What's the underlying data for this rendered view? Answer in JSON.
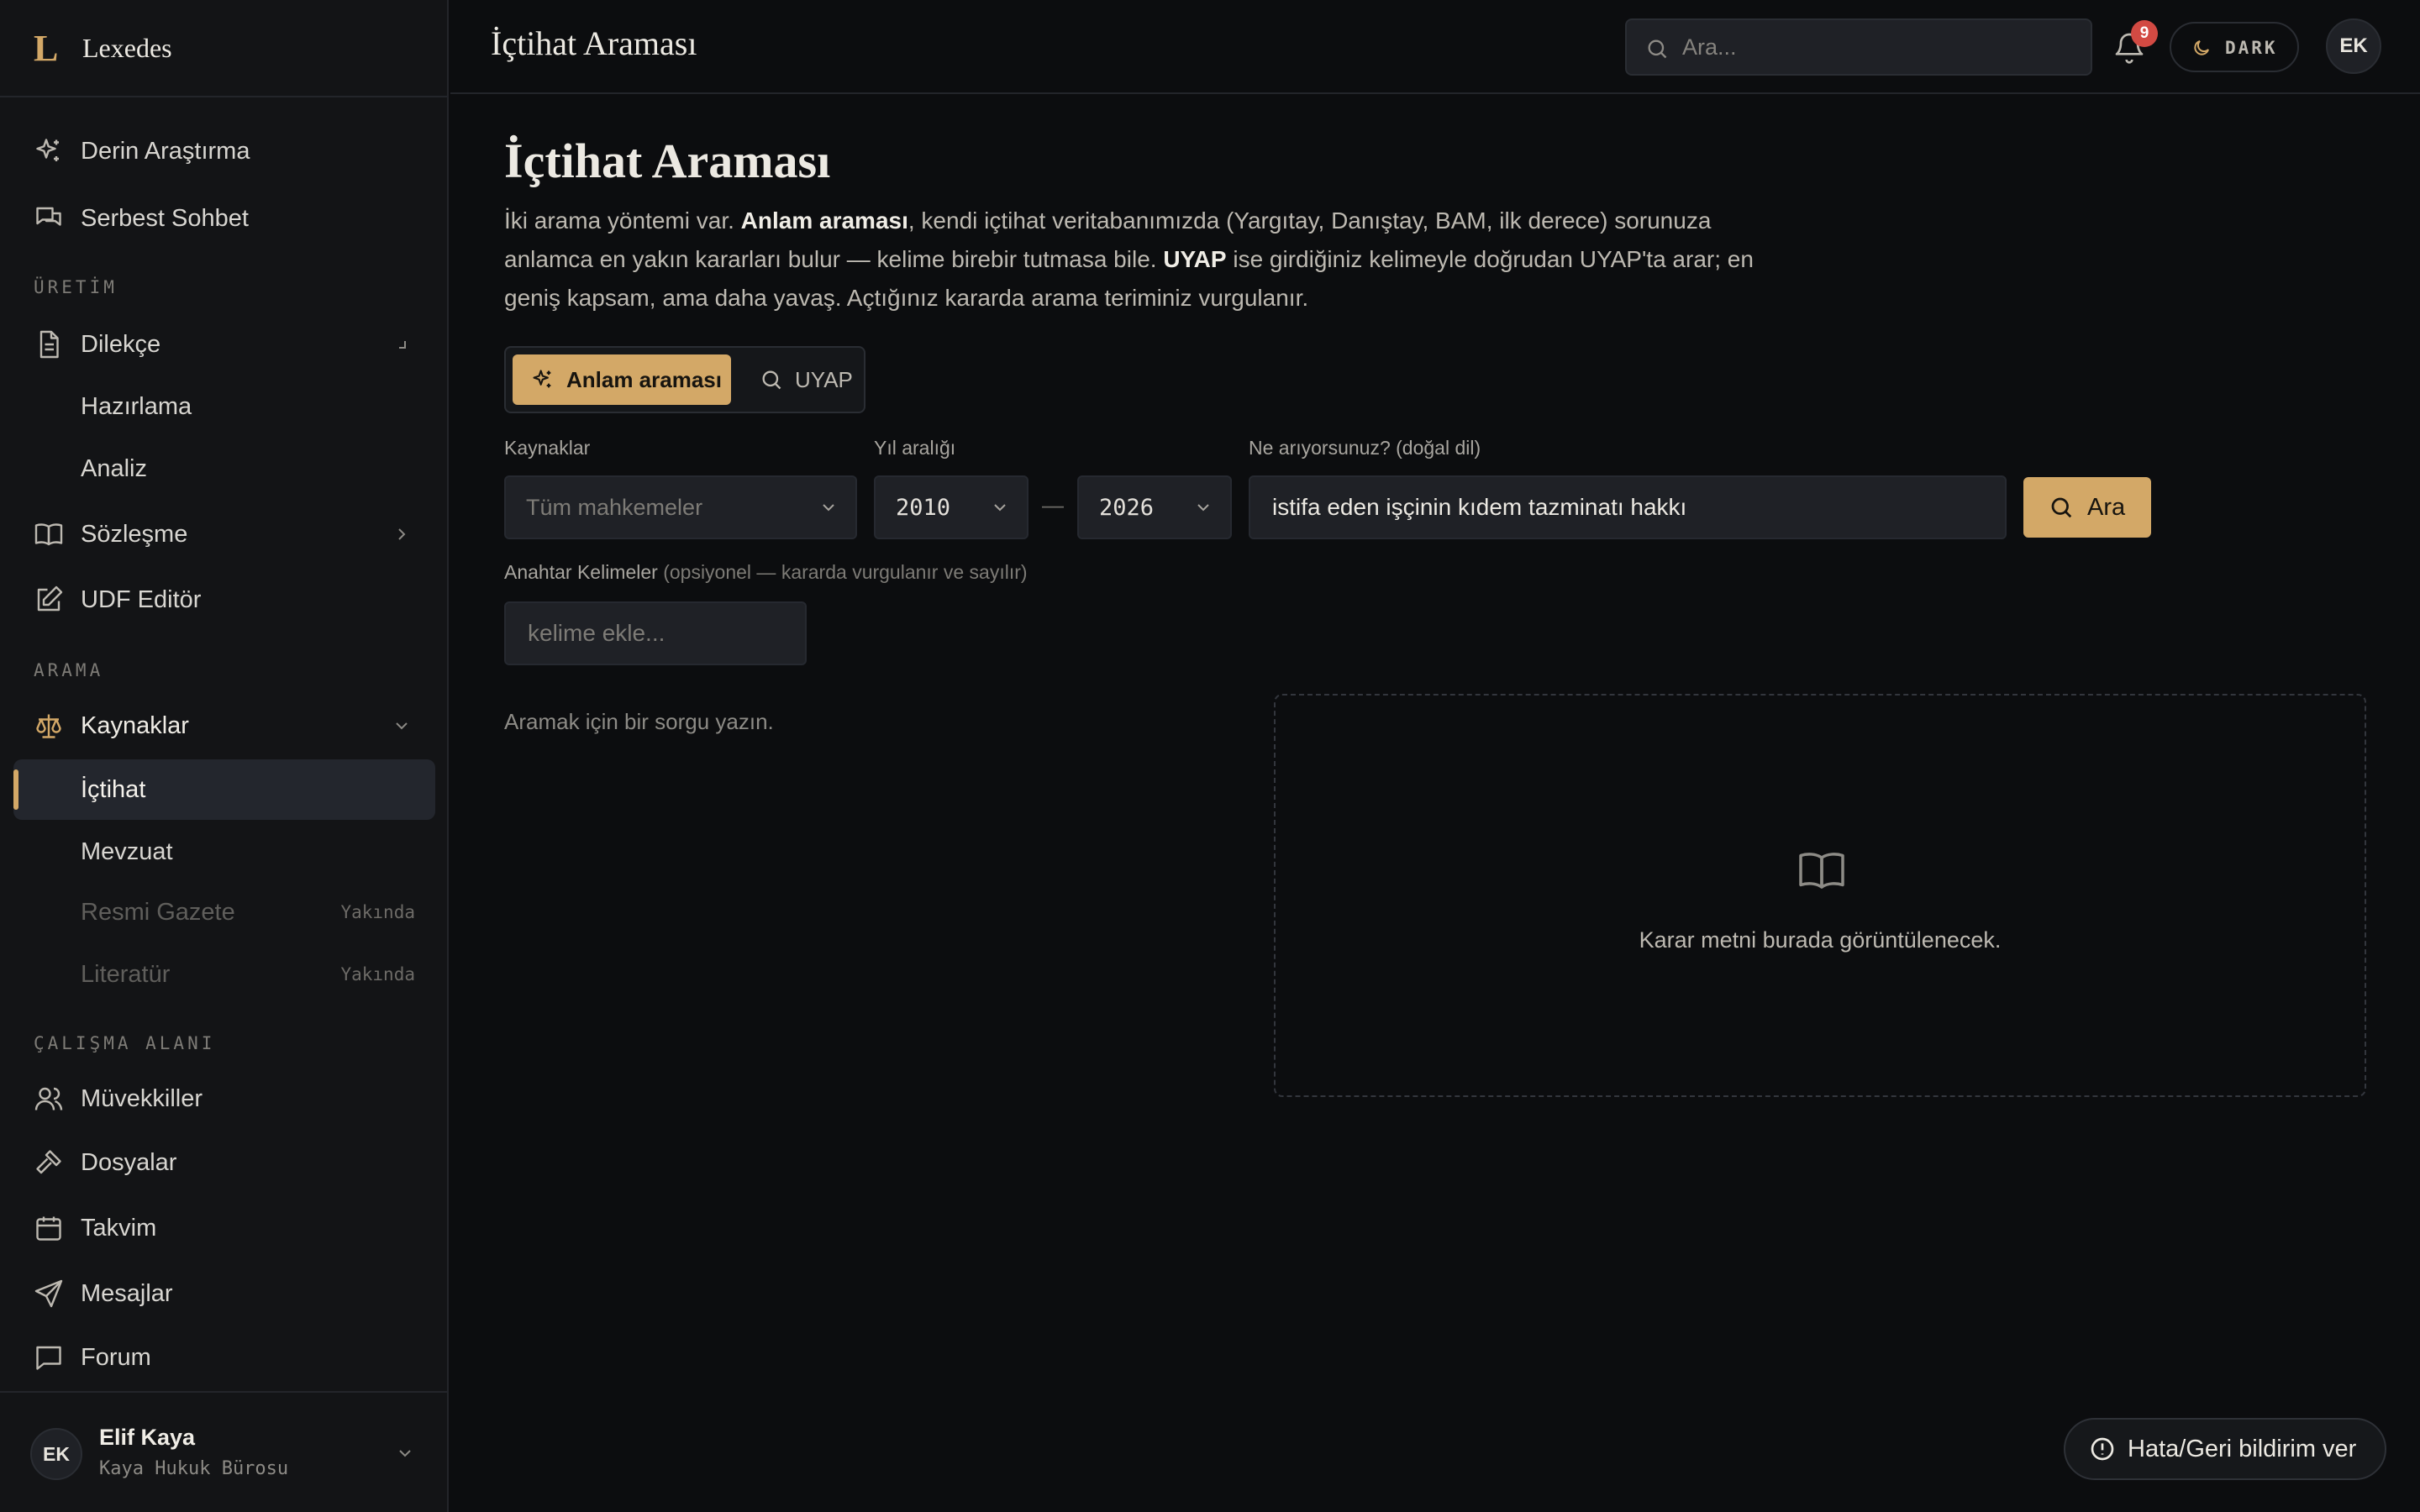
{
  "app": {
    "logo": "L",
    "name": "Lexedes"
  },
  "sidebar": {
    "top_items": [
      {
        "label": "Derin Araştırma",
        "icon": "sparkles-icon"
      },
      {
        "label": "Serbest Sohbet",
        "icon": "chat-icon"
      }
    ],
    "sections": {
      "uretim": "ÜRETİM",
      "arama": "ARAMA",
      "calisma": "ÇALIŞMA ALANI"
    },
    "uretim_items": {
      "dilekce": "Dilekçe",
      "hazirlama": "Hazırlama",
      "analiz": "Analiz",
      "sozlesme": "Sözleşme",
      "udf": "UDF Editör"
    },
    "arama_items": {
      "kaynaklar": "Kaynaklar",
      "ictihat": "İçtihat",
      "mevzuat": "Mevzuat",
      "resmi_gazete": "Resmi Gazete",
      "literatur": "Literatür",
      "soon": "Yakında"
    },
    "calisma_items": {
      "muvekkiller": "Müvekkiller",
      "dosyalar": "Dosyalar",
      "takvim": "Takvim",
      "mesajlar": "Mesajlar",
      "forum": "Forum"
    },
    "user": {
      "initials": "EK",
      "name": "Elif Kaya",
      "org": "Kaya Hukuk Bürosu"
    }
  },
  "topbar": {
    "title": "İçtihat Araması",
    "search_placeholder": "Ara...",
    "notifications_count": "9",
    "theme_label": "DARK",
    "avatar_initials": "EK"
  },
  "main": {
    "heading": "İçtihat Araması",
    "desc": {
      "p1": "İki arama yöntemi var. ",
      "b1": "Anlam araması",
      "p2": ", kendi içtihat veritabanımızda (Yargıtay, Danıştay, BAM, ilk derece) sorunuza anlamca en yakın kararları bulur — kelime birebir tutmasa bile. ",
      "b2": "UYAP",
      "p3": " ise girdiğiniz kelimeyle doğrudan UYAP'ta arar; en geniş kapsam, ama daha yavaş. Açtığınız kararda arama teriminiz vurgulanır."
    },
    "modes": {
      "semantic": "Anlam araması",
      "uyap": "UYAP"
    },
    "filters": {
      "sources_label": "Kaynaklar",
      "sources_value": "Tüm mahkemeler",
      "year_label": "Yıl aralığı",
      "year_from": "2010",
      "year_to": "2026",
      "year_sep": "—",
      "query_label": "Ne arıyorsunuz? (doğal dil)",
      "query_value": "istifa eden işçinin kıdem tazminatı hakkı",
      "search_button": "Ara",
      "keywords_label": "Anahtar Kelimeler",
      "keywords_hint": "(opsiyonel — kararda vurgulanır ve sayılır)",
      "keywords_placeholder": "kelime ekle..."
    },
    "empty_hint": "Aramak için bir sorgu yazın.",
    "viewer_text": "Karar metni burada görüntülenecek."
  },
  "feedback_label": "Hata/Geri bildirim ver",
  "colors": {
    "accent": "#d3a867",
    "badge": "#d24a43",
    "background": "#0c0d0f",
    "sidebar": "#131416"
  }
}
